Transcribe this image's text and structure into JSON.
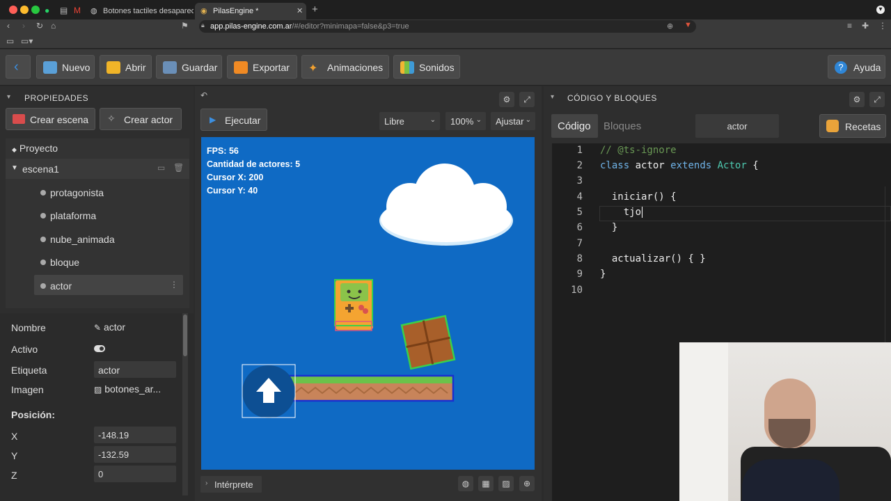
{
  "browser": {
    "tabs": [
      {
        "title": "Botones tactiles desaparecen - cor"
      },
      {
        "title": "PilasEngine *"
      }
    ],
    "url_domain": "app.pilas-engine.com.ar",
    "url_path": "/#/editor?minimapa=false&p3=true"
  },
  "toolbar": {
    "items": [
      {
        "label": "Nuevo"
      },
      {
        "label": "Abrir"
      },
      {
        "label": "Guardar"
      },
      {
        "label": "Exportar"
      },
      {
        "label": "Animaciones"
      },
      {
        "label": "Sonidos"
      }
    ],
    "help": "Ayuda"
  },
  "left_panel": {
    "title": "PROPIEDADES",
    "create_scene": "Crear escena",
    "create_actor": "Crear actor",
    "project": "Proyecto",
    "scene": "escena1",
    "actors": [
      "protagonista",
      "plataforma",
      "nube_animada",
      "bloque",
      "actor"
    ],
    "props": {
      "name_label": "Nombre",
      "name_value": "actor",
      "active_label": "Activo",
      "tag_label": "Etiqueta",
      "tag_value": "actor",
      "image_label": "Imagen",
      "image_value": "botones_ar...",
      "position_label": "Posición:",
      "x_label": "X",
      "x_value": "-148.19",
      "y_label": "Y",
      "y_value": "-132.59",
      "z_label": "Z",
      "z_value": "0"
    }
  },
  "center_panel": {
    "run": "Ejecutar",
    "mode": "Libre",
    "zoom": "100%",
    "fit": "Ajustar",
    "hud": {
      "fps": "FPS: 56",
      "actors": "Cantidad de actores: 5",
      "cursor_x": "Cursor X: 200",
      "cursor_y": "Cursor Y: 40"
    },
    "interpreter": "Intérprete"
  },
  "right_panel": {
    "title": "CÓDIGO Y BLOQUES",
    "tab_code": "Código",
    "tab_blocks": "Bloques",
    "actor_name": "actor",
    "recipes": "Recetas",
    "line_numbers": [
      "1",
      "2",
      "3",
      "4",
      "5",
      "6",
      "7",
      "8",
      "9",
      "10"
    ],
    "code": {
      "l1": "// @ts-ignore",
      "l2_kw1": "class",
      "l2_name": " actor ",
      "l2_kw2": "extends",
      "l2_type": " Actor",
      "l2_end": " {",
      "l4": "  iniciar() {",
      "l5": "    tjo",
      "l6": "  }",
      "l8": "  actualizar() { }",
      "l9": "}"
    }
  },
  "colors": {
    "accent_blue": "#2f86d6",
    "stage_blue": "#0f6ac4",
    "code_bg": "#1e1e1e"
  }
}
